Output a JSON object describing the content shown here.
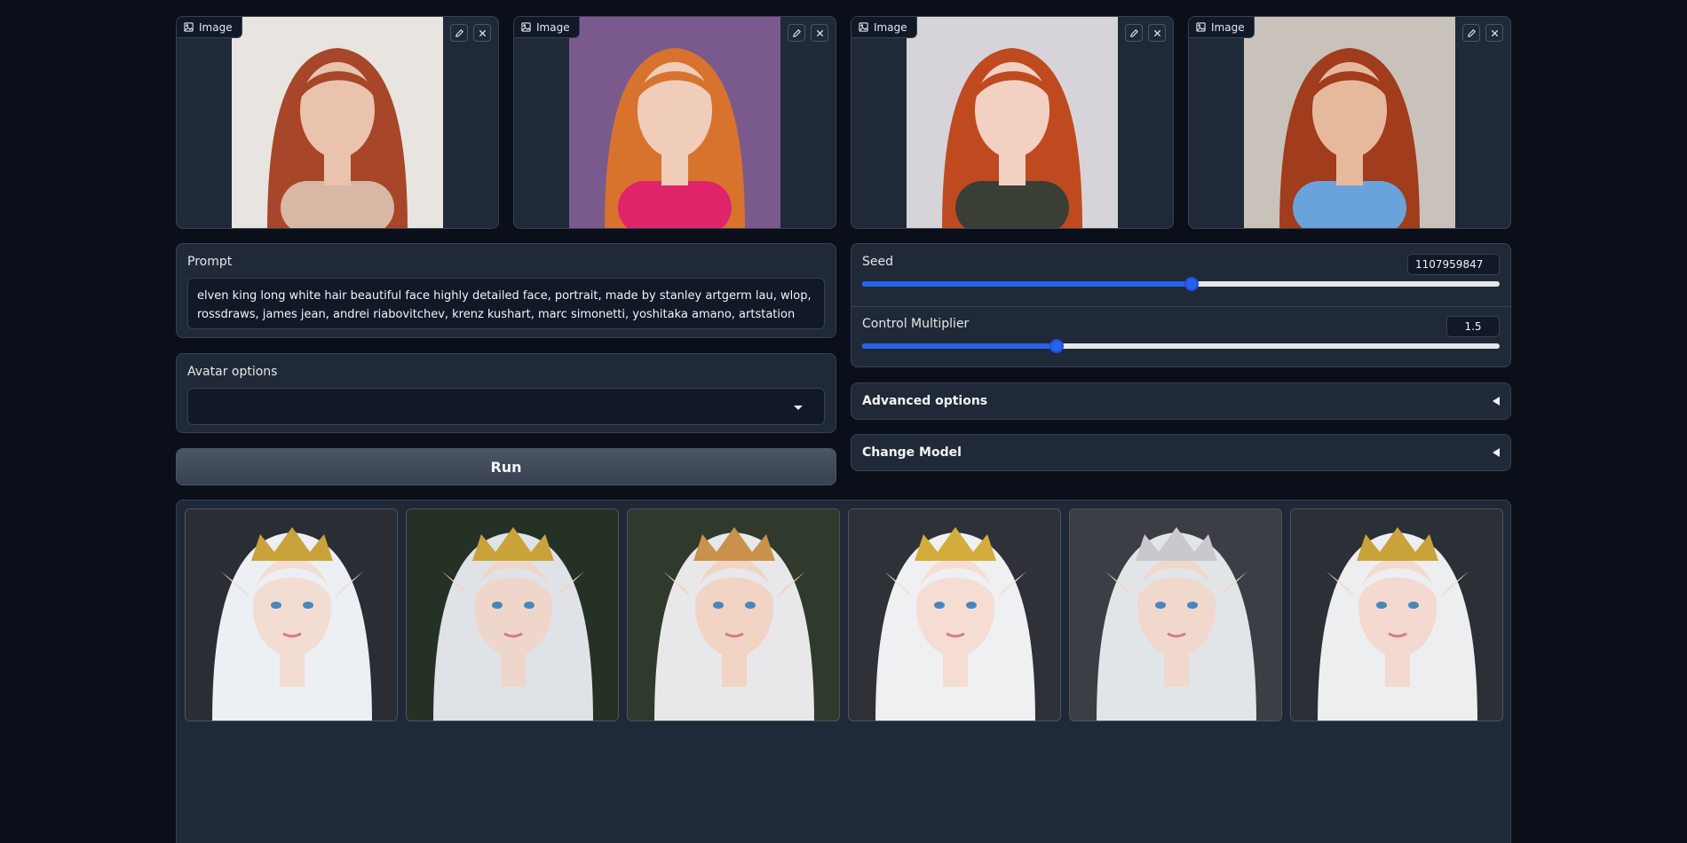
{
  "input_images": [
    {
      "label": "Image",
      "bg": "#e8e4df",
      "hair": "#a8462a",
      "skin": "#e9c3ae",
      "shirt": "#d9b7a5"
    },
    {
      "label": "Image",
      "bg": "#7a5a8c",
      "hair": "#d8732e",
      "skin": "#f0cdb9",
      "shirt": "#e0246a"
    },
    {
      "label": "Image",
      "bg": "#d6d4d8",
      "hair": "#c04a20",
      "skin": "#f2d1c3",
      "shirt": "#3a3f35"
    },
    {
      "label": "Image",
      "bg": "#c9c2bb",
      "hair": "#a13c1c",
      "skin": "#e7b99c",
      "shirt": "#6aa3dc"
    }
  ],
  "prompt": {
    "label": "Prompt",
    "value": "elven king long white hair beautiful face highly detailed face, portrait, made by stanley artgerm lau, wlop, rossdraws, james jean, andrei riabovitchev, krenz kushart, marc simonetti, yoshitaka amano, artstation"
  },
  "avatar": {
    "label": "Avatar options",
    "selected": ""
  },
  "run_label": "Run",
  "seed": {
    "label": "Seed",
    "value": "1107959847",
    "fraction": 0.517
  },
  "control": {
    "label": "Control Multiplier",
    "value": "1.5",
    "fraction": 0.305
  },
  "advanced_label": "Advanced options",
  "change_model_label": "Change Model",
  "gallery": [
    {
      "bg": "#2a2d33",
      "hair": "#eceff3",
      "skin": "#f3dcd2",
      "crown": "#c9a23a"
    },
    {
      "bg": "#263126",
      "hair": "#dfe3e7",
      "skin": "#efd6cb",
      "crown": "#c9a23a"
    },
    {
      "bg": "#2f3a2c",
      "hair": "#e8e8ea",
      "skin": "#f1d4c4",
      "crown": "#c9914a"
    },
    {
      "bg": "#2e3238",
      "hair": "#eef0f2",
      "skin": "#f5ddd3",
      "crown": "#d4ac3c"
    },
    {
      "bg": "#3b3f45",
      "hair": "#e2e5e8",
      "skin": "#f0d8cc",
      "crown": "#c7c9cc"
    },
    {
      "bg": "#2b3036",
      "hair": "#eceef0",
      "skin": "#f3d9cf",
      "crown": "#c9a23a"
    }
  ],
  "colors": {
    "accent": "#2563eb",
    "panel": "#1f2937",
    "background": "#0b0f19"
  }
}
